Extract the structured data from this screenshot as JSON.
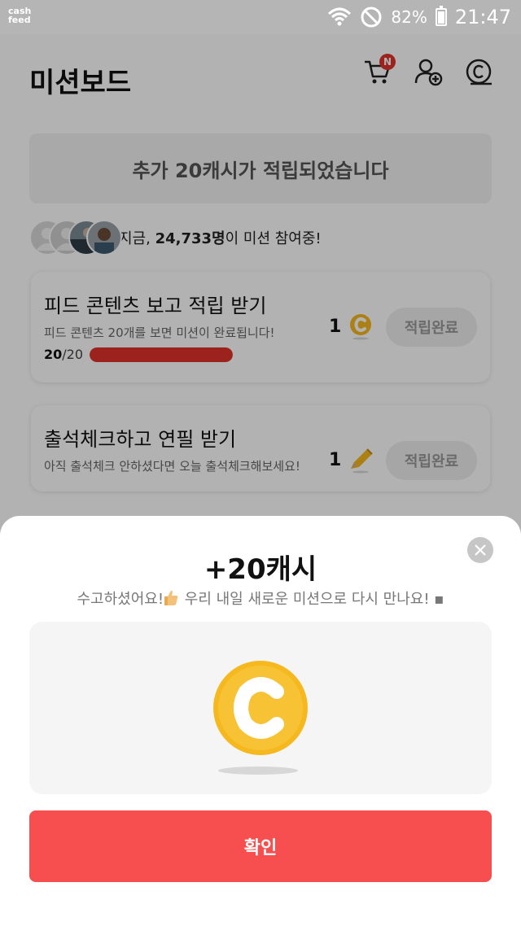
{
  "status_bar": {
    "logo_line1": "cash",
    "logo_line2": "feed",
    "battery": "82%",
    "time": "21:47",
    "icons": [
      "wifi-icon",
      "do-not-disturb-icon",
      "battery-icon"
    ]
  },
  "header": {
    "title": "미션보드",
    "cart_badge": "N",
    "icons": [
      "cart-icon",
      "add-friend-icon",
      "coin-history-icon"
    ]
  },
  "banner": {
    "text": "추가 20캐시가 적립되었습니다"
  },
  "participants": {
    "prefix": "지금, ",
    "count": "24,733명",
    "suffix": "이 미션 참여중!"
  },
  "missions": [
    {
      "title": "피드 콘텐츠 보고 적립 받기",
      "subtitle": "피드 콘텐츠 20개를 보면 미션이 완료됩니다!",
      "progress_done": "20",
      "progress_total": "/20",
      "progress_fraction": 1.0,
      "reward_amount": "1",
      "reward_icon": "coin-icon",
      "button": "적립완료"
    },
    {
      "title": "출석체크하고 연필 받기",
      "subtitle": "아직 출석체크 안하셨다면 오늘 출석체크해보세요!",
      "reward_amount": "1",
      "reward_icon": "pencil-icon",
      "button": "적립완료"
    }
  ],
  "modal": {
    "title": "+20캐시",
    "message_part1": "수고하셨어요!",
    "message_part2": " 우리 내일 새로운 미션으로 다시 만나요! ▪",
    "confirm": "확인",
    "close_icon": "close-icon"
  },
  "colors": {
    "accent_red": "#e0322b",
    "confirm_button": "#f74f4f",
    "coin_gold": "#f5b81f"
  }
}
